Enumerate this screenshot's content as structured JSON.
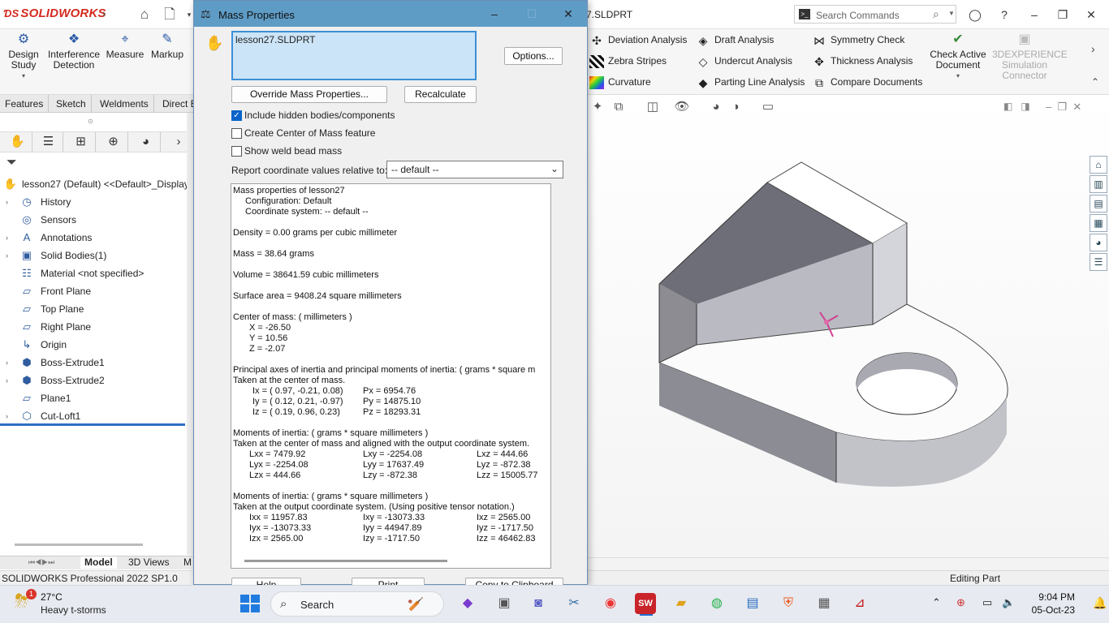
{
  "app": {
    "logo": "SOLIDWORKS",
    "document_title": "7.SLDPRT",
    "search_placeholder": "Search Commands"
  },
  "ribbon": {
    "left_buttons": [
      {
        "label": "Design Study",
        "icon": "design-study-icon"
      },
      {
        "label": "Interference Detection",
        "icon": "interference-detection-icon"
      },
      {
        "label": "Measure",
        "icon": "measure-icon"
      },
      {
        "label": "Markup",
        "icon": "markup-icon"
      }
    ],
    "col1": [
      "Deviation Analysis",
      "Zebra Stripes",
      "Curvature"
    ],
    "col2": [
      "Draft Analysis",
      "Undercut Analysis",
      "Parting Line Analysis"
    ],
    "col3": [
      "Symmetry Check",
      "Thickness Analysis",
      "Compare Documents"
    ],
    "check_active": "Check Active Document",
    "simulation": "3DEXPERIENCE Simulation Connector"
  },
  "cm_tabs": [
    "Features",
    "Sketch",
    "Weldments",
    "Direct E"
  ],
  "tree": {
    "root": "lesson27 (Default) <<Default>_Display",
    "items": [
      {
        "label": "History",
        "expandable": true,
        "icon": "history-icon"
      },
      {
        "label": "Sensors",
        "expandable": false,
        "icon": "sensors-icon"
      },
      {
        "label": "Annotations",
        "expandable": true,
        "icon": "annotations-icon"
      },
      {
        "label": "Solid Bodies(1)",
        "expandable": true,
        "icon": "solid-bodies-icon"
      },
      {
        "label": "Material <not specified>",
        "expandable": false,
        "icon": "material-icon"
      },
      {
        "label": "Front Plane",
        "expandable": false,
        "icon": "plane-icon"
      },
      {
        "label": "Top Plane",
        "expandable": false,
        "icon": "plane-icon"
      },
      {
        "label": "Right Plane",
        "expandable": false,
        "icon": "plane-icon"
      },
      {
        "label": "Origin",
        "expandable": false,
        "icon": "origin-icon"
      },
      {
        "label": "Boss-Extrude1",
        "expandable": true,
        "icon": "boss-extrude-icon"
      },
      {
        "label": "Boss-Extrude2",
        "expandable": true,
        "icon": "boss-extrude-icon"
      },
      {
        "label": "Plane1",
        "expandable": false,
        "icon": "plane-icon"
      },
      {
        "label": "Cut-Loft1",
        "expandable": true,
        "icon": "cut-loft-icon"
      }
    ]
  },
  "bottom_tabs": [
    "Model",
    "3D Views",
    "M"
  ],
  "status": {
    "left": "SOLIDWORKS Professional 2022 SP1.0",
    "right": "Editing Part"
  },
  "dialog": {
    "title": "Mass Properties",
    "selection": "lesson27.SLDPRT",
    "options_button": "Options...",
    "override_button": "Override Mass Properties...",
    "recalculate_button": "Recalculate",
    "checkbox_hidden": "Include hidden bodies/components",
    "checkbox_hidden_checked": true,
    "checkbox_com": "Create Center of Mass feature",
    "checkbox_weld": "Show weld bead mass",
    "coord_label": "Report coordinate values relative to:",
    "coord_value": "-- default --",
    "help_button": "Help",
    "print_button": "Print",
    "copy_button": "Copy to Clipboard",
    "results": {
      "line1": "Mass properties of lesson27",
      "line2": "Configuration: Default",
      "line3": "Coordinate system: -- default --",
      "density": "Density = 0.00 grams per cubic millimeter",
      "mass": "Mass = 38.64 grams",
      "volume": "Volume = 38641.59 cubic millimeters",
      "surface": "Surface area = 9408.24  square millimeters",
      "com_head": "Center of mass: ( millimeters )",
      "com_x": "X = -26.50",
      "com_y": "Y = 10.56",
      "com_z": "Z = -2.07",
      "pa_head": "Principal axes of inertia and principal moments of inertia: ( grams *  square m",
      "pa_sub": "Taken at the center of mass.",
      "ix": "Ix = ( 0.97, -0.21,  0.08)",
      "iy": "Iy = ( 0.12,  0.21, -0.97)",
      "iz": "Iz = ( 0.19,  0.96,  0.23)",
      "px": "Px = 6954.76",
      "py": "Py = 14875.10",
      "pz": "Pz = 18293.31",
      "moi1_head": "Moments of inertia: ( grams *  square millimeters )",
      "moi1_sub": "Taken at the center of mass and aligned with the output coordinate system.",
      "lxx": "Lxx = 7479.92",
      "lxy": "Lxy = -2254.08",
      "lxz": "Lxz = 444.66",
      "lyx": "Lyx = -2254.08",
      "lyy": "Lyy = 17637.49",
      "lyz": "Lyz = -872.38",
      "lzx": "Lzx = 444.66",
      "lzy": "Lzy = -872.38",
      "lzz": "Lzz = 15005.77",
      "moi2_head": "Moments of inertia: ( grams *  square millimeters )",
      "moi2_sub": "Taken at the output coordinate system. (Using positive tensor notation.)",
      "ixx": "Ixx = 11957.83",
      "ixy": "Ixy = -13073.33",
      "ixz": "Ixz = 2565.00",
      "iyx": "Iyx = -13073.33",
      "iyy": "Iyy = 44947.89",
      "iyz": "Iyz = -1717.50",
      "izx": "Izx = 2565.00",
      "izy": "Izy = -1717.50",
      "izz": "Izz = 46462.83"
    }
  },
  "taskbar": {
    "weather_temp": "27°C",
    "weather_cond": "Heavy t-storms",
    "search": "Search",
    "time": "9:04 PM",
    "date": "05-Oct-23"
  },
  "colors": {
    "dialog_title": "#5e9cc6",
    "selection_bg": "#cce4f7",
    "brand_red": "#d42a20",
    "rollback_bar": "#2f6fc4"
  }
}
